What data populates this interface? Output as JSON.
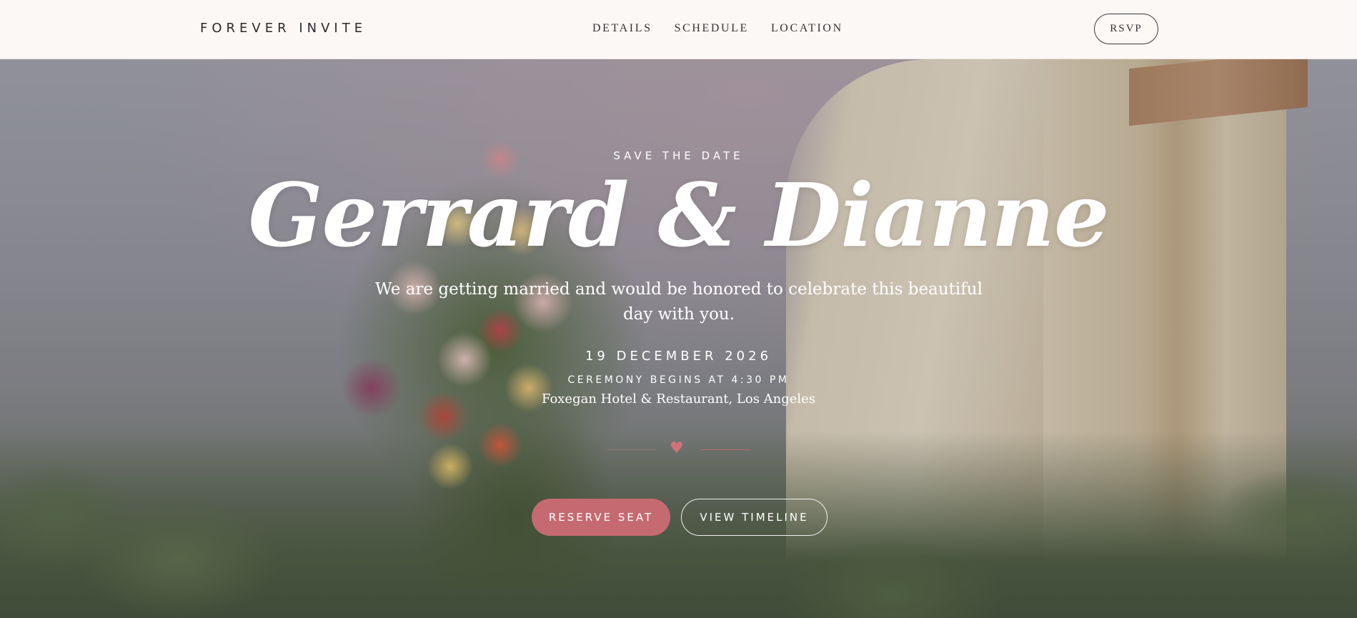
{
  "header": {
    "brand": "FOREVER INVITE",
    "nav": [
      {
        "label": "DETAILS"
      },
      {
        "label": "SCHEDULE"
      },
      {
        "label": "LOCATION"
      }
    ],
    "rsvp_label": "RSVP"
  },
  "hero": {
    "eyebrow": "SAVE THE DATE",
    "names": "Gerrard & Dianne",
    "tagline": "We are getting married and would be honored to celebrate this beautiful day with you.",
    "date": "19 DECEMBER 2026",
    "ceremony": "CEREMONY BEGINS AT 4:30 PM",
    "venue": "Foxegan Hotel & Restaurant, Los Angeles",
    "divider_icon": "heart-icon",
    "primary_button": "RESERVE SEAT",
    "secondary_button": "VIEW TIMELINE"
  },
  "colors": {
    "accent": "#c56a70",
    "header_bg": "#fcf8f6",
    "text_dark": "#2a2a2a"
  }
}
